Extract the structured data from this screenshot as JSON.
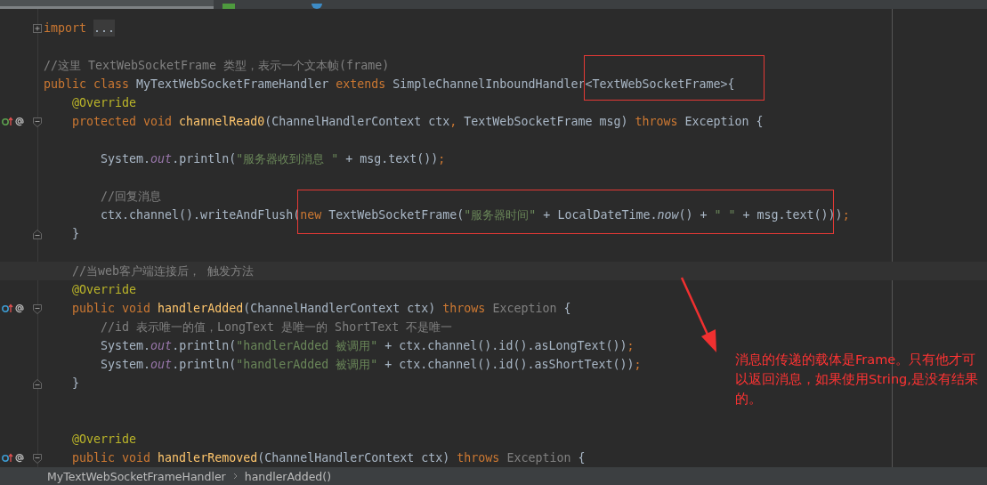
{
  "tabs": [
    {
      "kind": "class",
      "selected": true
    },
    {
      "kind": "html",
      "selected": false
    },
    {
      "kind": "script",
      "selected": false
    }
  ],
  "editor": {
    "lines": [
      {
        "current": false,
        "fold": {
          "kind": "collapsed"
        },
        "tokens": [
          {
            "kind": "keyword",
            "text": "import "
          },
          {
            "kind": "folded",
            "text": "..."
          }
        ]
      },
      {
        "current": false
      },
      {
        "current": false,
        "tokens": [
          {
            "kind": "comment",
            "text": "//这里 TextWebSocketFrame 类型，表示一个文本帧(frame)"
          }
        ]
      },
      {
        "current": false,
        "tokens": [
          {
            "kind": "keyword",
            "text": "public class "
          },
          {
            "kind": "plain",
            "text": "MyTextWebSocketFrameHandler "
          },
          {
            "kind": "keyword",
            "text": "extends "
          },
          {
            "kind": "plain",
            "text": "SimpleChannelInboundHandler<TextWebSocketFrame>{"
          }
        ]
      },
      {
        "current": false,
        "tokens": [
          {
            "kind": "annotation",
            "text": "    @Override"
          }
        ]
      },
      {
        "current": false,
        "marker": {
          "kind": "implements"
        },
        "fold": {
          "kind": "open"
        },
        "tokens": [
          {
            "kind": "keyword",
            "text": "    protected void "
          },
          {
            "kind": "method",
            "text": "channelRead0"
          },
          {
            "kind": "plain",
            "text": "(ChannelHandlerContext ctx"
          },
          {
            "kind": "keyword",
            "text": ", "
          },
          {
            "kind": "plain",
            "text": "TextWebSocketFrame msg) "
          },
          {
            "kind": "keyword",
            "text": "throws "
          },
          {
            "kind": "plain",
            "text": "Exception {"
          }
        ]
      },
      {
        "current": false
      },
      {
        "current": false,
        "tokens": [
          {
            "kind": "plain",
            "text": "        System."
          },
          {
            "kind": "field",
            "text": "out"
          },
          {
            "kind": "plain",
            "text": ".println("
          },
          {
            "kind": "string",
            "text": "\"服务器收到消息 \""
          },
          {
            "kind": "plain",
            "text": " + msg.text())"
          },
          {
            "kind": "keyword",
            "text": ";"
          }
        ]
      },
      {
        "current": false
      },
      {
        "current": false,
        "tokens": [
          {
            "kind": "comment",
            "text": "        //回复消息"
          }
        ]
      },
      {
        "current": false,
        "tokens": [
          {
            "kind": "plain",
            "text": "        ctx.channel().writeAndFlush("
          },
          {
            "kind": "keyword",
            "text": "new "
          },
          {
            "kind": "plain",
            "text": "TextWebSocketFrame("
          },
          {
            "kind": "string",
            "text": "\"服务器时间\""
          },
          {
            "kind": "plain",
            "text": " + LocalDateTime."
          },
          {
            "kind": "static",
            "text": "now"
          },
          {
            "kind": "plain",
            "text": "() + "
          },
          {
            "kind": "string",
            "text": "\" \""
          },
          {
            "kind": "plain",
            "text": " + msg.text()))"
          },
          {
            "kind": "keyword",
            "text": ";"
          }
        ]
      },
      {
        "current": false,
        "fold": {
          "kind": "close"
        },
        "tokens": [
          {
            "kind": "plain",
            "text": "    }"
          }
        ]
      },
      {
        "current": false
      },
      {
        "current": true,
        "tokens": [
          {
            "kind": "comment",
            "text": "    //当web客户端连接后， 触发方法"
          }
        ]
      },
      {
        "current": false,
        "tokens": [
          {
            "kind": "annotation",
            "text": "    @Override"
          }
        ]
      },
      {
        "current": false,
        "marker": {
          "kind": "overrides"
        },
        "fold": {
          "kind": "open"
        },
        "tokens": [
          {
            "kind": "keyword",
            "text": "    public void "
          },
          {
            "kind": "method",
            "text": "handlerAdded"
          },
          {
            "kind": "plain",
            "text": "(ChannelHandlerContext ctx) "
          },
          {
            "kind": "keyword",
            "text": "throws "
          },
          {
            "kind": "unused",
            "text": "Exception "
          },
          {
            "kind": "plain",
            "text": "{"
          }
        ]
      },
      {
        "current": false,
        "tokens": [
          {
            "kind": "comment",
            "text": "        //id 表示唯一的值，LongText 是唯一的 ShortText 不是唯一"
          }
        ]
      },
      {
        "current": false,
        "tokens": [
          {
            "kind": "plain",
            "text": "        System."
          },
          {
            "kind": "field",
            "text": "out"
          },
          {
            "kind": "plain",
            "text": ".println("
          },
          {
            "kind": "string",
            "text": "\"handlerAdded 被调用\""
          },
          {
            "kind": "plain",
            "text": " + ctx.channel().id().asLongText())"
          },
          {
            "kind": "keyword",
            "text": ";"
          }
        ]
      },
      {
        "current": false,
        "tokens": [
          {
            "kind": "plain",
            "text": "        System."
          },
          {
            "kind": "field",
            "text": "out"
          },
          {
            "kind": "plain",
            "text": ".println("
          },
          {
            "kind": "string",
            "text": "\"handlerAdded 被调用\""
          },
          {
            "kind": "plain",
            "text": " + ctx.channel().id().asShortText())"
          },
          {
            "kind": "keyword",
            "text": ";"
          }
        ]
      },
      {
        "current": false,
        "fold": {
          "kind": "close"
        },
        "tokens": [
          {
            "kind": "plain",
            "text": "    }"
          }
        ]
      },
      {
        "current": false
      },
      {
        "current": false
      },
      {
        "current": false,
        "tokens": [
          {
            "kind": "annotation",
            "text": "    @Override"
          }
        ]
      },
      {
        "current": false,
        "marker": {
          "kind": "overrides"
        },
        "fold": {
          "kind": "open"
        },
        "tokens": [
          {
            "kind": "keyword",
            "text": "    public void "
          },
          {
            "kind": "method",
            "text": "handlerRemoved"
          },
          {
            "kind": "plain",
            "text": "(ChannelHandlerContext ctx) "
          },
          {
            "kind": "keyword",
            "text": "throws "
          },
          {
            "kind": "unused",
            "text": "Exception "
          },
          {
            "kind": "plain",
            "text": "{"
          }
        ]
      }
    ]
  },
  "callout": {
    "text": "消息的传递的载体是Frame。只有他才可以返回消息，如果使用String,是没有结果的。"
  },
  "breadcrumbs": [
    "MyTextWebSocketFrameHandler",
    "handlerAdded()"
  ]
}
